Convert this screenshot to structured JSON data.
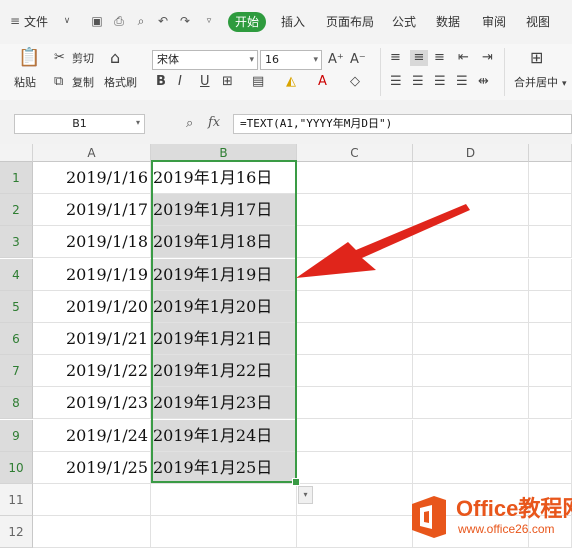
{
  "menubar": {
    "file_label": "文件",
    "tabs": [
      "开始",
      "插入",
      "页面布局",
      "公式",
      "数据",
      "审阅",
      "视图"
    ]
  },
  "ribbon": {
    "paste": "粘贴",
    "cut": "剪切",
    "copy": "复制",
    "format_painter": "格式刷",
    "font_name": "宋体",
    "font_size": "16",
    "merge_center": "合并居中"
  },
  "formula_bar": {
    "name_box": "B1",
    "fx": "fx",
    "formula": "=TEXT(A1,\"YYYY年M月D日\")"
  },
  "sheet": {
    "columns": [
      "A",
      "B",
      "C",
      "D"
    ],
    "rows": [
      "1",
      "2",
      "3",
      "4",
      "5",
      "6",
      "7",
      "8",
      "9",
      "10",
      "11",
      "12"
    ],
    "col_a": [
      "2019/1/16",
      "2019/1/17",
      "2019/1/18",
      "2019/1/19",
      "2019/1/20",
      "2019/1/21",
      "2019/1/22",
      "2019/1/23",
      "2019/1/24",
      "2019/1/25"
    ],
    "col_b": [
      "2019年1月16日",
      "2019年1月17日",
      "2019年1月18日",
      "2019年1月19日",
      "2019年1月20日",
      "2019年1月21日",
      "2019年1月22日",
      "2019年1月23日",
      "2019年1月24日",
      "2019年1月25日"
    ]
  },
  "watermark": {
    "brand": "Office教程网",
    "url": "www.office26.com"
  },
  "colors": {
    "accent_green": "#2e9b3e",
    "arrow_red": "#e0251b",
    "logo_orange": "#e8561b"
  }
}
